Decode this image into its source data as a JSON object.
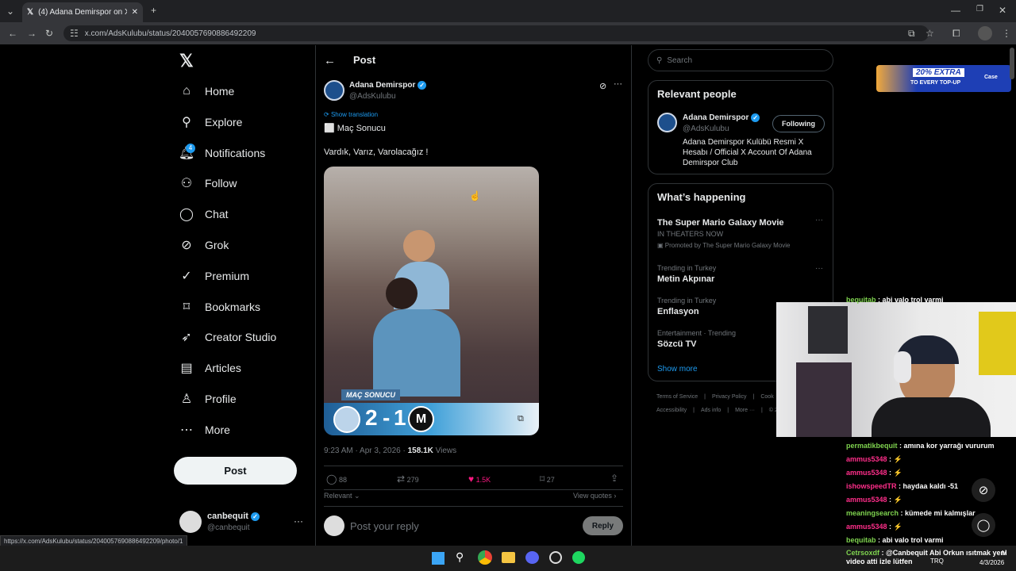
{
  "browser": {
    "tab_title": "(4) Adana Demirspor on X: \"⬜",
    "url": "x.com/AdsKulubu/status/2040057690886492209",
    "status_url": "https://x.com/AdsKulubu/status/2040057690886492209/photo/1"
  },
  "sidebar": {
    "items": [
      {
        "label": "Home",
        "icon": "home-icon"
      },
      {
        "label": "Explore",
        "icon": "search-icon"
      },
      {
        "label": "Notifications",
        "icon": "bell-icon"
      },
      {
        "label": "Follow",
        "icon": "add-person-icon"
      },
      {
        "label": "Chat",
        "icon": "chat-icon"
      },
      {
        "label": "Grok",
        "icon": "grok-icon"
      },
      {
        "label": "Premium",
        "icon": "premium-icon"
      },
      {
        "label": "Bookmarks",
        "icon": "bookmark-icon"
      },
      {
        "label": "Creator Studio",
        "icon": "rocket-icon"
      },
      {
        "label": "Articles",
        "icon": "article-icon"
      },
      {
        "label": "Profile",
        "icon": "person-icon"
      },
      {
        "label": "More",
        "icon": "more-icon"
      }
    ],
    "notifications_badge": "4",
    "post_label": "Post",
    "account": {
      "name": "canbequit",
      "handle": "@canbequit"
    }
  },
  "post": {
    "header": "Post",
    "author": "Adana Demirspor",
    "handle": "@AdsKulubu",
    "show_translation": "Show translation",
    "line1": "⬜ Maç Sonucu",
    "line2": "Vardık, Varız, Varolacağız !",
    "media": {
      "banner": "MAÇ SONUCU",
      "score_home": "2",
      "score_sep": "-",
      "score_away": "1"
    },
    "timestamp": "9:23 AM · Apr 3, 2026 · ",
    "views_count": "158.1K",
    "views_label": " Views",
    "replies": "88",
    "reposts": "279",
    "likes": "1.5K",
    "bookmarks": "27",
    "relevant": "Relevant",
    "view_quotes": "View quotes",
    "reply_placeholder": "Post your reply",
    "reply_button": "Reply"
  },
  "right": {
    "search_placeholder": "Search",
    "relevant_title": "Relevant people",
    "person": {
      "name": "Adana Demirspor",
      "handle": "@AdsKulubu",
      "bio": "Adana Demirspor Kulübü Resmi X Hesabı / Official X Account Of Adana Demirspor Club",
      "follow": "Following"
    },
    "happening_title": "What’s happening",
    "trends": [
      {
        "meta": "",
        "title": "The Super Mario Galaxy Movie",
        "sub": "IN THEATERS NOW",
        "promo": "Promoted by The Super Mario Galaxy Movie"
      },
      {
        "meta": "Trending in Turkey",
        "title": "Metin Akpınar"
      },
      {
        "meta": "Trending in Turkey",
        "title": "Enflasyon"
      },
      {
        "meta": "Entertainment · Trending",
        "title": "Sözcü TV"
      }
    ],
    "show_more": "Show more",
    "footer1": [
      "Terms of Service",
      "Privacy Policy",
      "Cook"
    ],
    "footer2": [
      "Accessibility",
      "Ads info",
      "More ···",
      "© 20"
    ]
  },
  "ad": {
    "line1": "20% EXTRA",
    "line2": "TO EVERY TOP-UP",
    "brand": "Case"
  },
  "stream_chat": [
    {
      "user": "bequitab",
      "msg": " : abi valo trol varmi",
      "color": "#7fd34f"
    },
    {
      "user": "permatikbequit",
      "msg": " : amına kor yarrağı vururum",
      "color": "#7fd34f"
    },
    {
      "user": "ammus5348",
      "msg": " : ",
      "color": "#ff2e8a"
    },
    {
      "user": "ammus5348",
      "msg": " : ",
      "color": "#ff2e8a"
    },
    {
      "user": "ishowspeedTR",
      "msg": " : haydaa kaldı -51",
      "color": "#ff2e8a"
    },
    {
      "user": "ammus5348",
      "msg": " : ",
      "color": "#ff2e8a"
    },
    {
      "user": "meaningsearch",
      "msg": " : kümede mi kalmışlar",
      "color": "#7fd34f"
    },
    {
      "user": "ammus5348",
      "msg": " : ",
      "color": "#ff2e8a"
    },
    {
      "user": "bequitab",
      "msg": " : abi valo trol varmi",
      "color": "#7fd34f"
    },
    {
      "user": "Cetrsoxdf",
      "msg": " : @Canbequit Abi Orkun ısıtmak yeni video atti izle lütfen",
      "color": "#7fd34f"
    }
  ],
  "taskbar": {
    "lang": "TRQ",
    "date": "4/3/2026",
    "time_partial": "M"
  }
}
